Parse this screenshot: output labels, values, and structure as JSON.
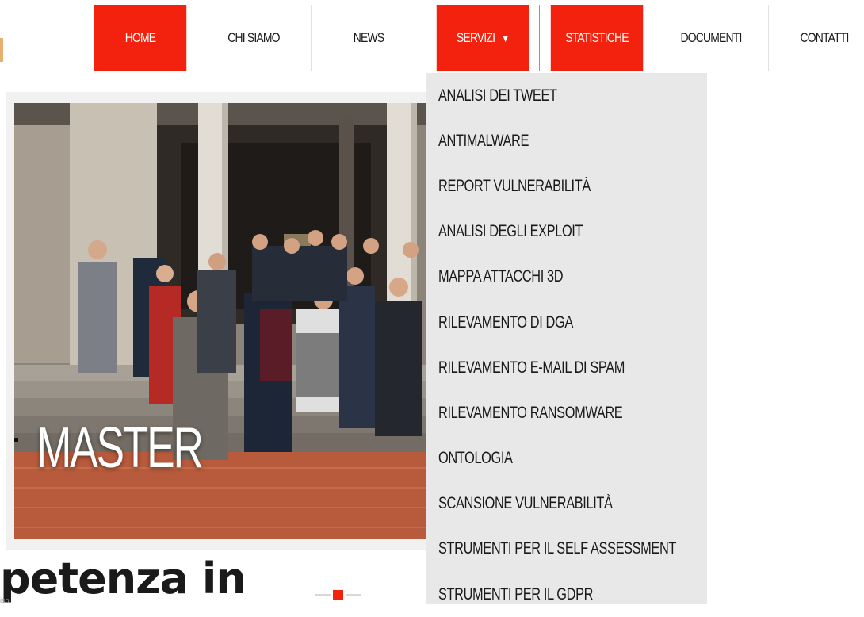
{
  "nav": {
    "items": [
      {
        "label": "HOME",
        "active": true
      },
      {
        "label": "CHI SIAMO",
        "active": false
      },
      {
        "label": "NEWS",
        "active": false
      },
      {
        "label": "SERVIZI",
        "active": true,
        "has_caret": true
      },
      {
        "label": "STATISTICHE",
        "active": true
      },
      {
        "label": "DOCUMENTI",
        "active": false
      },
      {
        "label": "CONTATTI",
        "active": false
      }
    ],
    "caret_glyph": "▼",
    "accent_color": "#f2220f"
  },
  "dropdown": {
    "items": [
      "ANALISI DEI TWEET",
      "ANTIMALWARE",
      "REPORT VULNERABILITÀ",
      "ANALISI DEGLI EXPLOIT",
      "MAPPA ATTACCHI 3D",
      "RILEVAMENTO DI DGA",
      "RILEVAMENTO E-MAIL DI SPAM",
      "RILEVAMENTO RANSOMWARE",
      "ONTOLOGIA",
      "SCANSIONE VULNERABILITÀ",
      "STRUMENTI PER IL SELF ASSESSMENT",
      "STRUMENTI PER IL GDPR"
    ],
    "background": "#e8e8e8"
  },
  "hero": {
    "title": "MASTER"
  },
  "heading": {
    "text": "petenza in",
    "sub": "isp"
  }
}
